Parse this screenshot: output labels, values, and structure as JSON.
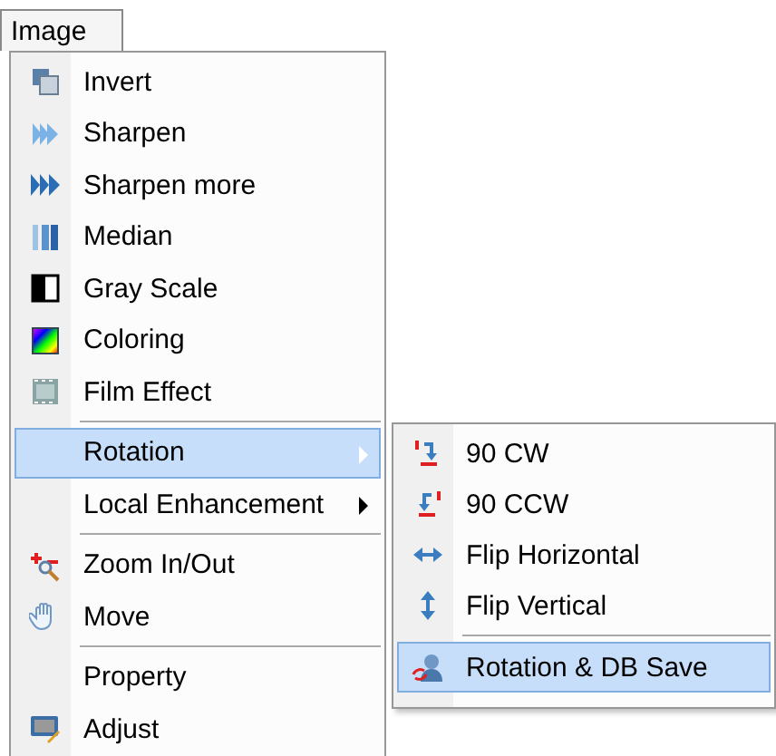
{
  "menu_bar": {
    "title": "Image"
  },
  "menu": [
    {
      "kind": "item",
      "label": "Invert",
      "selected": false,
      "submenu": false
    },
    {
      "kind": "item",
      "label": "Sharpen",
      "selected": false,
      "submenu": false
    },
    {
      "kind": "item",
      "label": "Sharpen more",
      "selected": false,
      "submenu": false
    },
    {
      "kind": "item",
      "label": "Median",
      "selected": false,
      "submenu": false
    },
    {
      "kind": "item",
      "label": "Gray Scale",
      "selected": false,
      "submenu": false
    },
    {
      "kind": "item",
      "label": "Coloring",
      "selected": false,
      "submenu": false
    },
    {
      "kind": "item",
      "label": "Film Effect",
      "selected": false,
      "submenu": false
    },
    {
      "kind": "separator"
    },
    {
      "kind": "item",
      "label": "Rotation",
      "selected": true,
      "submenu": true
    },
    {
      "kind": "item",
      "label": "Local Enhancement",
      "selected": false,
      "submenu": true
    },
    {
      "kind": "separator"
    },
    {
      "kind": "item",
      "label": "Zoom In/Out",
      "selected": false,
      "submenu": false
    },
    {
      "kind": "item",
      "label": "Move",
      "selected": false,
      "submenu": false
    },
    {
      "kind": "separator"
    },
    {
      "kind": "item",
      "label": "Property",
      "selected": false,
      "submenu": false
    },
    {
      "kind": "item",
      "label": "Adjust",
      "selected": false,
      "submenu": false
    }
  ],
  "submenu": [
    {
      "kind": "item",
      "label": "90 CW",
      "selected": false
    },
    {
      "kind": "item",
      "label": "90 CCW",
      "selected": false
    },
    {
      "kind": "item",
      "label": "Flip Horizontal",
      "selected": false
    },
    {
      "kind": "item",
      "label": "Flip Vertical",
      "selected": false
    },
    {
      "kind": "separator"
    },
    {
      "kind": "item",
      "label": "Rotation & DB Save",
      "selected": true
    }
  ]
}
